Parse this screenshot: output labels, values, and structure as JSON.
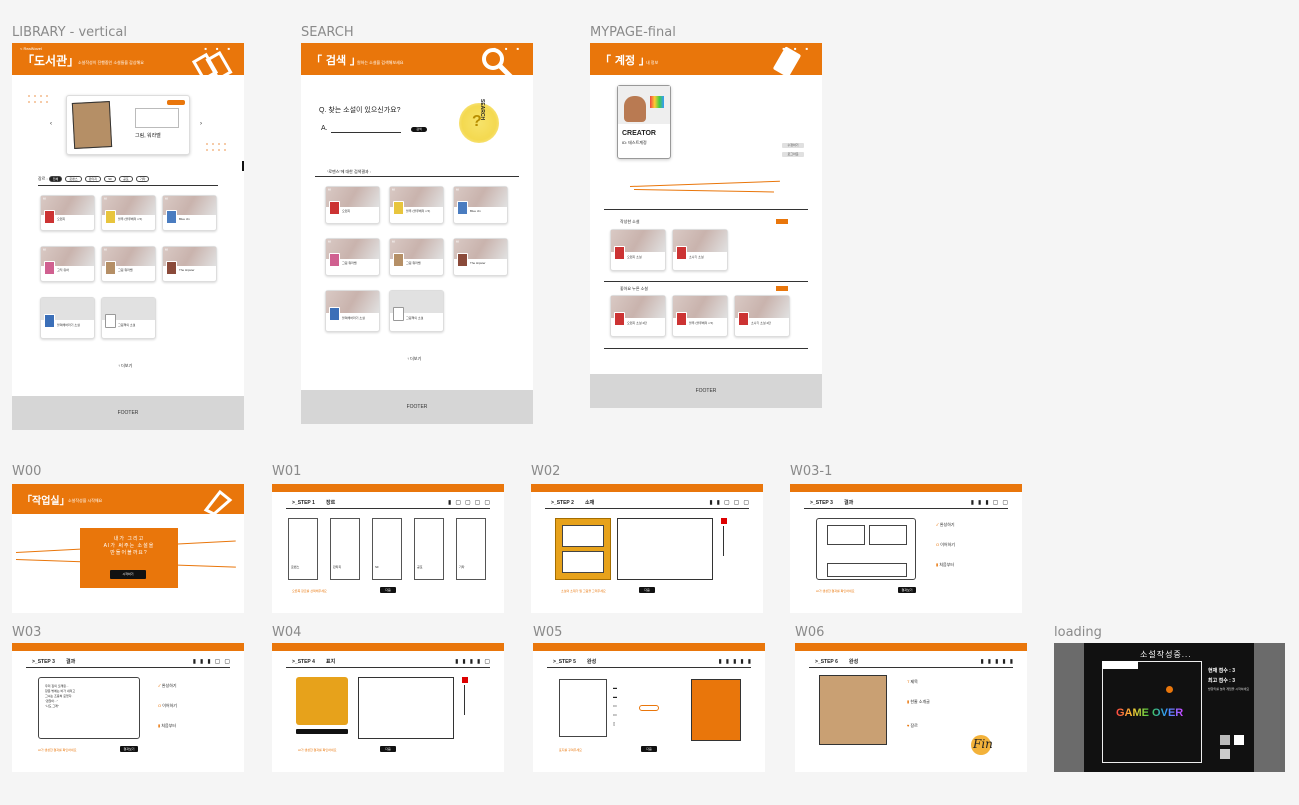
{
  "frames": {
    "library": {
      "label": "LIBRARY - vertical",
      "nav": "< RealNovel",
      "title": "「도서관」",
      "subtitle": "소설작성이 진행중인 소설들을 감상해요",
      "featured_name": "그림, 워라벨",
      "featured_quote": "“",
      "genre_label": "장르 :",
      "genres": [
        "전체",
        "로맨스",
        "판타지",
        "SF",
        "공포",
        "기타"
      ],
      "cards": [
        "오렌지",
        "블루 (블루베리 x 5)",
        "Blue Jin",
        "고딕 유하",
        "그림 워라벨",
        "The Hipster",
        "블랙해바라기 소설",
        "그림책의 소설"
      ],
      "more": "↑ 더보기",
      "footer": "FOOTER"
    },
    "search": {
      "label": "SEARCH",
      "title": "「 검색 」",
      "subtitle": "원하는 소설을 검색해보세요",
      "question": "Q. 찾는 소설이 있으신가요?",
      "answer_prefix": "A.",
      "search_button": "검색",
      "side_text": "SEARCH",
      "results_label": "“로맨스”에 대한 검색결과 :",
      "cards": [
        "오렌지",
        "블루 (블루베리 x 5)",
        "Blue Jin",
        "그림 워라벨",
        "그림 워라벨",
        "The Hipster",
        "블랙해바라기 소설",
        "그림책의 소설"
      ],
      "more": "↑ 더보기",
      "footer": "FOOTER"
    },
    "mypage": {
      "label": "MYPAGE-final",
      "title": "「 계정 」",
      "subtitle": "내 정보",
      "badge_role": "CREATOR",
      "badge_name": "ID: 테스트계정",
      "section1": "작성한 소설",
      "section2": "좋아요 누른 소설",
      "btn_edit": "수정하기",
      "btn_logout": "로그아웃",
      "cards1": [
        "오렌지 소설",
        "소나기 소설"
      ],
      "cards2": [
        "오렌지 소설 2탄",
        "블루 (블루베리 x 5)",
        "소나기 소설 2탄"
      ],
      "footer": "FOOTER"
    },
    "w00": {
      "label": "W00",
      "title": "「작업실」",
      "subtitle": "소설작성을 시작해요",
      "box_line1": "내가 그리고",
      "box_line2": "AI가 써주는 소설을",
      "box_line3": "만들어볼까요?",
      "box_button": "시작하기"
    },
    "w01": {
      "label": "W01",
      "step_prefix": ">_STEP",
      "step_no": "1",
      "step_name": "장르",
      "genres": [
        "로맨스",
        "판타지",
        "SF",
        "공포",
        "기타"
      ],
      "next": "다음",
      "note": "오른쪽 장르를 선택해주세요"
    },
    "w02": {
      "label": "W02",
      "step_prefix": ">_STEP",
      "step_no": "2",
      "step_name": "소재",
      "next": "다음",
      "note": "소설의 소재가 될 그림을 그려주세요"
    },
    "w031": {
      "label": "W03-1",
      "step_prefix": ">_STEP",
      "step_no": "3",
      "step_name": "결과",
      "opts": [
        "완성하기",
        "이어하기",
        "처음부터"
      ],
      "next": "결과보기",
      "note": "AI가 생성한 결과를 확인하세요"
    },
    "w03": {
      "label": "W03",
      "step_prefix": ">_STEP",
      "step_no": "3",
      "step_name": "결과",
      "opts": [
        "완성하기",
        "이어하기",
        "처음부터"
      ],
      "story": [
        "우리 집의 오래된...",
        "창문 밖에는 비가 내리고",
        "그녀는 조용히 웃었다.",
        "“괜찮아...”",
        "“나도 그래”"
      ],
      "next": "결과보기",
      "note": "AI가 생성한 결과를 확인하세요"
    },
    "w04": {
      "label": "W04",
      "step_prefix": ">_STEP",
      "step_no": "4",
      "step_name": "표지",
      "next": "다음",
      "note": "AI가 생성한 결과를 확인하세요"
    },
    "w05": {
      "label": "W05",
      "step_prefix": ">_STEP",
      "step_no": "5",
      "step_name": "완성",
      "next": "다음",
      "note": "표지를 꾸며주세요"
    },
    "w06": {
      "label": "W06",
      "step_prefix": ">_STEP",
      "step_no": "6",
      "step_name": "완성",
      "opts": [
        "제목",
        "한줄 소개글",
        "장르"
      ],
      "signature": "Fin"
    },
    "loading": {
      "label": "loading",
      "title": "소설작성중...",
      "score_now": "현재 점수 : 3",
      "score_best": "최고 점수 : 3",
      "hint": "방향키를 눌러 게임을 시작하세요",
      "game_over": "GAME OVER"
    }
  },
  "colors": {
    "accent": "#e9760b",
    "footer": "#d6d6d6",
    "dark": "#111111"
  }
}
